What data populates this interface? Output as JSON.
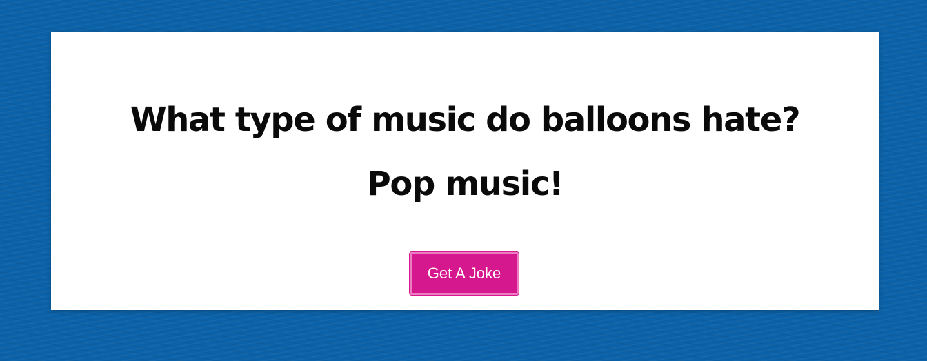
{
  "joke": {
    "setup": "What type of music do balloons hate?",
    "punchline": "Pop music!"
  },
  "actions": {
    "get_joke_label": "Get A Joke"
  },
  "colors": {
    "background": "#0b62a8",
    "card": "#ffffff",
    "button": "#d6188e",
    "button_border": "#ee7cc2",
    "text": "#0a0a0a"
  }
}
